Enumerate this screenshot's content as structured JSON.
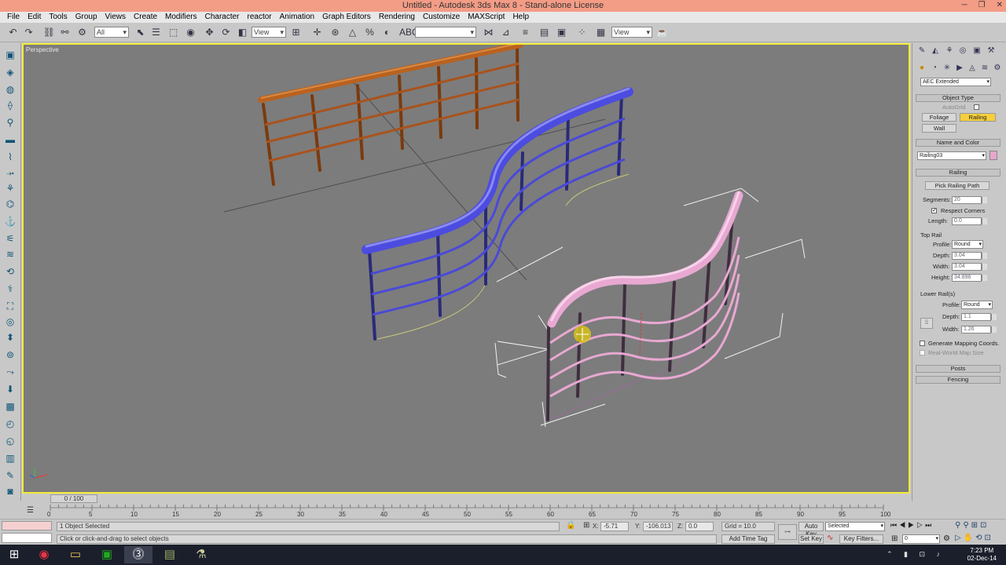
{
  "window": {
    "title": "Untitled - Autodesk 3ds Max 8 - Stand-alone License"
  },
  "menu": [
    "File",
    "Edit",
    "Tools",
    "Group",
    "Views",
    "Create",
    "Modifiers",
    "Character",
    "reactor",
    "Animation",
    "Graph Editors",
    "Rendering",
    "Customize",
    "MAXScript",
    "Help"
  ],
  "toolbar": {
    "selection_filter": "All",
    "ref_coord": "View",
    "named_sel": "",
    "view2": "View"
  },
  "viewport": {
    "label": "Perspective"
  },
  "command_panel": {
    "category": "AEC Extended",
    "object_type_title": "Object Type",
    "autogrid_label": "AutoGrid",
    "foliage_btn": "Foliage",
    "railing_btn": "Railing",
    "wall_btn": "Wall",
    "name_color_title": "Name and Color",
    "object_name": "Railing03",
    "object_color": "#e6a6cc",
    "railing_title": "Railing",
    "pick_path_btn": "Pick Railing Path",
    "segments_label": "Segments:",
    "segments_value": "20",
    "respect_corners_label": "Respect Corners",
    "length_label": "Length:",
    "length_value": "0.0",
    "top_rail_label": "Top Rail",
    "profile_label": "Profile:",
    "top_profile": "Round",
    "depth_label": "Depth:",
    "top_depth": "3.04",
    "width_label": "Width:",
    "top_width": "3.04",
    "height_label": "Height:",
    "top_height": "34.896",
    "lower_rails_label": "Lower Rail(s)",
    "lower_profile": "Round",
    "lower_depth": "1.1",
    "lower_width": "1.26",
    "gen_mapping_label": "Generate Mapping Coords.",
    "real_world_label": "Real-World Map Size",
    "posts_title": "Posts",
    "fencing_title": "Fencing"
  },
  "timeline": {
    "slider": "0 / 100",
    "ticks": [
      "0",
      "5",
      "10",
      "15",
      "20",
      "25",
      "30",
      "35",
      "40",
      "45",
      "50",
      "55",
      "60",
      "65",
      "70",
      "75",
      "80",
      "85",
      "90",
      "95",
      "100"
    ]
  },
  "status": {
    "selection_info": "1 Object Selected",
    "prompt": "Click or click-and-drag to select objects",
    "x_label": "X:",
    "x_value": "-5.71",
    "y_label": "Y:",
    "y_value": "-106.013",
    "z_label": "Z:",
    "z_value": "0.0",
    "grid": "Grid = 10.0",
    "add_time_tag": "Add Time Tag",
    "auto_key": "Auto Key",
    "set_key": "Set Key",
    "key_mode": "Selected",
    "key_filters": "Key Filters...",
    "frame": "0"
  },
  "taskbar": {
    "time": "7:23 PM",
    "date": "02-Dec-14"
  },
  "colors": {
    "title_bg": "#f39c86",
    "viewport_border": "#f2ea3a",
    "railing_wood": "#b9621f",
    "railing_blue": "#4c4ce0",
    "railing_pink": "#e8a8d2",
    "active_btn": "#f6cf3a"
  }
}
